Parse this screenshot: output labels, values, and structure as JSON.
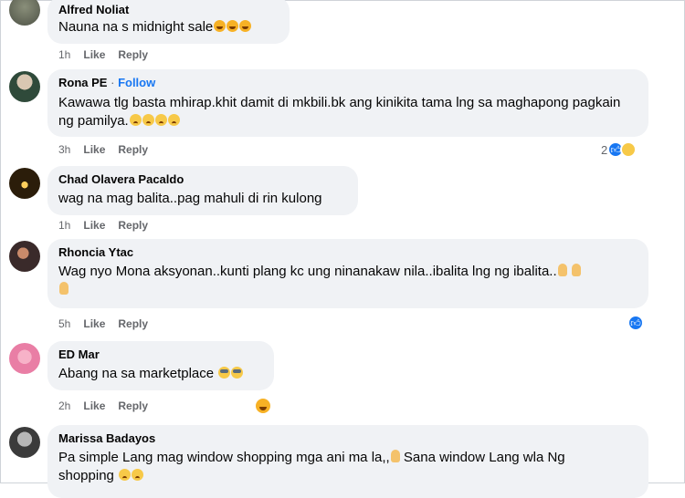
{
  "comments": [
    {
      "author": "Alfred Noliat",
      "text": "Nauna na s midnight sale",
      "time": "1h",
      "like": "Like",
      "reply": "Reply"
    },
    {
      "author": "Rona PE",
      "follow": "Follow",
      "separator": "·",
      "text": "Kawawa tlg basta mhirap.khit damit di mkbili.bk ang kinikita tama lng sa maghapong pagkain ng pamilya.",
      "time": "3h",
      "like": "Like",
      "reply": "Reply",
      "reaction_count": "2"
    },
    {
      "author": "Chad Olavera Pacaldo",
      "text": "wag na mag balita..pag mahuli di rin kulong",
      "time": "1h",
      "like": "Like",
      "reply": "Reply"
    },
    {
      "author": "Rhoncia Ytac",
      "text": "Wag nyo Mona aksyonan..kunti plang kc ung ninanakaw nila..ibalita lng ng ibalita..",
      "time": "5h",
      "like": "Like",
      "reply": "Reply"
    },
    {
      "author": "ED Mar",
      "text": "Abang na sa marketplace",
      "time": "2h",
      "like": "Like",
      "reply": "Reply"
    },
    {
      "author": "Marissa Badayos",
      "text_line1": "Pa simple Lang mag window shopping mga ani ma la,,",
      "text_line1_b": "Sana window Lang wla Ng",
      "text_line2": "shopping"
    }
  ],
  "icons": {
    "like_reaction": "like-icon",
    "sad_reaction": "sad-face-icon",
    "haha_reaction": "laughing-face-icon"
  },
  "colors": {
    "accent": "#1877f2",
    "bubble": "#f0f2f5",
    "meta": "#65676b"
  }
}
